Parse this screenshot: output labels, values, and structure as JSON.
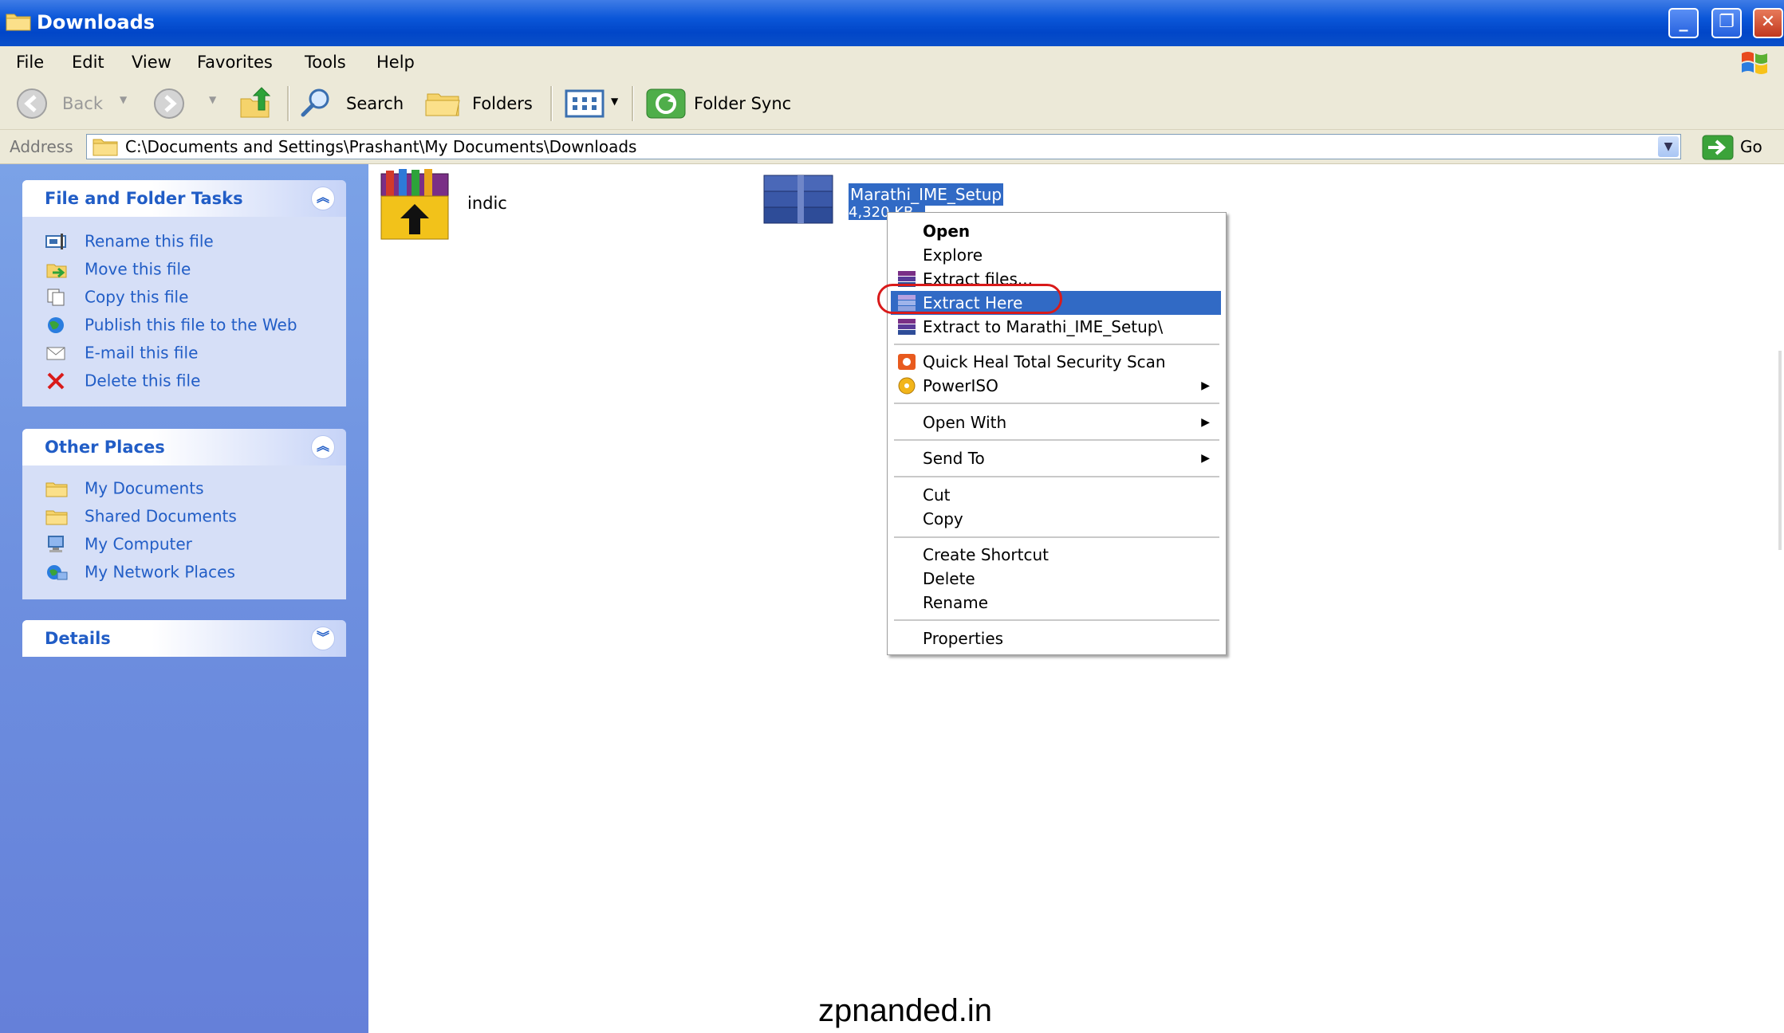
{
  "window": {
    "title": "Downloads",
    "icon": "folder-icon"
  },
  "menu": [
    "File",
    "Edit",
    "View",
    "Favorites",
    "Tools",
    "Help"
  ],
  "toolbar": {
    "back": "Back",
    "search": "Search",
    "folders": "Folders",
    "folder_sync": "Folder Sync"
  },
  "address": {
    "label": "Address",
    "path": "C:\\Documents and Settings\\Prashant\\My Documents\\Downloads",
    "go": "Go"
  },
  "file_tasks": {
    "title": "File and Folder Tasks",
    "items": [
      {
        "label": "Rename this file",
        "icon": "rename-icon"
      },
      {
        "label": "Move this file",
        "icon": "move-icon"
      },
      {
        "label": "Copy this file",
        "icon": "copy-icon"
      },
      {
        "label": "Publish this file to the Web",
        "icon": "globe-icon"
      },
      {
        "label": "E-mail this file",
        "icon": "email-icon"
      },
      {
        "label": "Delete this file",
        "icon": "delete-icon"
      }
    ]
  },
  "other_places": {
    "title": "Other Places",
    "items": [
      {
        "label": "My Documents",
        "icon": "folder-icon"
      },
      {
        "label": "Shared Documents",
        "icon": "folder-icon"
      },
      {
        "label": "My Computer",
        "icon": "computer-icon"
      },
      {
        "label": "My Network Places",
        "icon": "network-icon"
      }
    ]
  },
  "details": {
    "title": "Details"
  },
  "files": [
    {
      "name": "indic",
      "icon": "winrar-sfx-icon"
    },
    {
      "name": "Marathi_IME_Setup",
      "size": "4,320 KB",
      "icon": "winrar-archive-icon",
      "selected": true
    }
  ],
  "context_menu": {
    "items": [
      {
        "label": "Open",
        "bold": true
      },
      {
        "label": "Explore"
      },
      {
        "label": "Extract files...",
        "icon": "winrar-icon"
      },
      {
        "label": "Extract Here",
        "icon": "winrar-icon",
        "highlighted": true
      },
      {
        "label": "Extract to Marathi_IME_Setup\\",
        "icon": "winrar-icon"
      },
      {
        "label": "Quick Heal Total Security Scan",
        "icon": "quickheal-icon"
      },
      {
        "label": "PowerISO",
        "icon": "poweriso-icon",
        "submenu": true
      },
      {
        "label": "Open With",
        "submenu": true
      },
      {
        "label": "Send To",
        "submenu": true
      },
      {
        "label": "Cut"
      },
      {
        "label": "Copy"
      },
      {
        "label": "Create Shortcut"
      },
      {
        "label": "Delete"
      },
      {
        "label": "Rename"
      },
      {
        "label": "Properties"
      }
    ]
  },
  "watermark": "zpnanded.in",
  "colors": {
    "title_blue": "#0a56d8",
    "selection": "#316ac5",
    "link": "#215dc6",
    "annotation_red": "#d91a1a"
  }
}
